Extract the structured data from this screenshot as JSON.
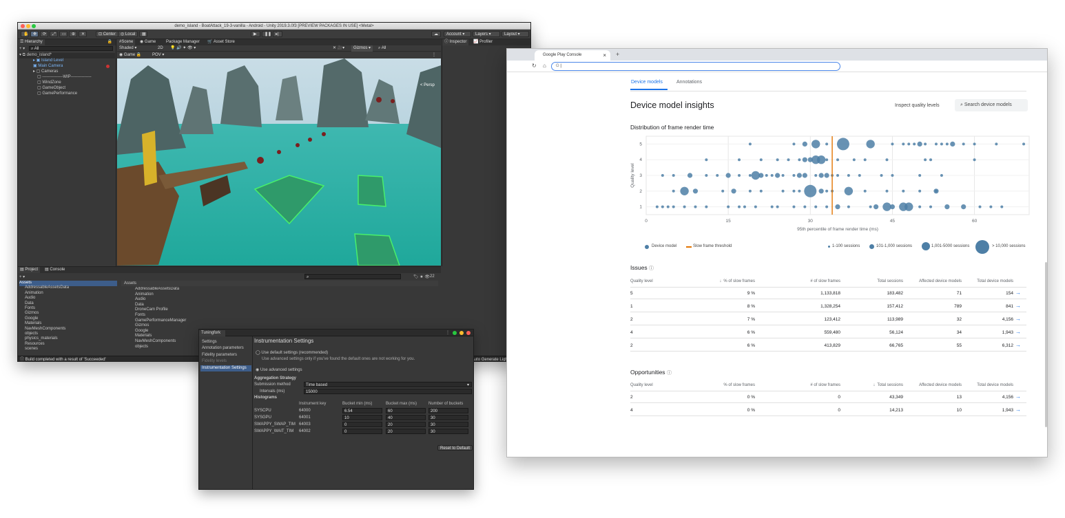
{
  "unity": {
    "title": "demo_island - BoatAttack_19-3-vanilla - Android - Unity 2019.3.0f3 [PREVIEW PACKAGES IN USE] <Metal>",
    "toolbar": {
      "center": "Center",
      "local": "Local",
      "account": "Account",
      "layers": "Layers",
      "layout": "Layout"
    },
    "hierarchy": {
      "tab": "Hierarchy",
      "search": "All",
      "scene": "demo_island*",
      "items": [
        "Island Level",
        "Main Camera",
        "Cameras",
        "---------------WIP---------------",
        "WindZone",
        "GameObject",
        "GamePerformance"
      ]
    },
    "scene_tabs": [
      "Scene",
      "Game",
      "Package Manager",
      "Asset Store"
    ],
    "scene_bar": {
      "shading": "Shaded",
      "mode": "2D",
      "gizmos": "Gizmos",
      "all": "All"
    },
    "game_bar": {
      "game": "Game",
      "pov": "POV"
    },
    "persp_label": "< Persp",
    "inspector_tabs": [
      "Inspector",
      "Profiler"
    ],
    "project_tabs": [
      "Project",
      "Console"
    ],
    "project_count": "22",
    "project_tree": [
      "Assets",
      "AddressableAssetsData",
      "Animation",
      "Audio",
      "Data",
      "Fonts",
      "Gizmos",
      "Google",
      "Materials",
      "NavMeshComponents",
      "objects",
      "physics_materials",
      "Resources",
      "scenes",
      "Scripts"
    ],
    "assets_header": "Assets",
    "assets_list": [
      "AddressableAssetsData",
      "Animation",
      "Audio",
      "Data",
      "DroneCam Profile",
      "Fonts",
      "GamePerformanceManager",
      "Gizmos",
      "Google",
      "Materials",
      "NavMeshComponents",
      "objects"
    ],
    "status": "Build completed with a result of 'Succeeded'",
    "status_right": "Auto Generate Lighting Off"
  },
  "tuningfork": {
    "tab": "Tuningfork",
    "nav": [
      "Settings",
      "Annotation parameters",
      "Fidelity parameters",
      "Fidelity levels",
      "Instrumentation Settings"
    ],
    "heading": "Instrumentation Settings",
    "opt_default": "Use default settings (recommended)",
    "opt_default_note": "Use advanced settings only if you've found the default ones are not working for you.",
    "opt_advanced": "Use advanced settings",
    "aggregation": "Aggregation Strategy",
    "submission_label": "Submission method",
    "submission_value": "Time based",
    "intervals_label": "Intervals (ms)",
    "intervals_value": "15000",
    "histograms": "Histograms",
    "hist_cols": [
      "Instrument key",
      "Bucket min (ms)",
      "Bucket max (ms)",
      "Number of buckets"
    ],
    "hist_rows": [
      [
        "SYSCPU",
        "64000",
        "6.54",
        "60",
        "200"
      ],
      [
        "SYSGPU",
        "64001",
        "10",
        "40",
        "30"
      ],
      [
        "SWAPPY_SWAP_TIM",
        "64003",
        "0",
        "20",
        "30"
      ],
      [
        "SWAPPY_WAIT_TIM",
        "64002",
        "0",
        "20",
        "30"
      ]
    ],
    "reset": "Reset to Default"
  },
  "chrome": {
    "tab_title": "Google Play Console",
    "tab_close": "×",
    "new_tab": "+",
    "addr_letter": "G",
    "addr_value": "|"
  },
  "console": {
    "tabs": [
      "Device models",
      "Annotations"
    ],
    "page_title": "Device model insights",
    "inspect": "Inspect quality levels",
    "search_placeholder": "Search device models",
    "chart_title": "Distribution of frame render time",
    "legend": {
      "device": "Device model",
      "threshold": "Slow frame threshold",
      "s1": "1-100 sessions",
      "s2": "101-1,000 sessions",
      "s3": "1,001-5000 sessions",
      "s4": "> 10,000 sessions"
    },
    "issues": {
      "title": "Issues",
      "cols": [
        "Quality level",
        "% of slow frames",
        "# of slow frames",
        "Total sessions",
        "Affected device models",
        "Total device models"
      ],
      "rows": [
        [
          "5",
          "9 %",
          "1,133,818",
          "183,482",
          "71",
          "154"
        ],
        [
          "1",
          "8 %",
          "1,328,254",
          "157,412",
          "789",
          "841"
        ],
        [
          "2",
          "7 %",
          "123,412",
          "113,989",
          "32",
          "4,156"
        ],
        [
          "4",
          "6 %",
          "559,480",
          "56,124",
          "34",
          "1,943"
        ],
        [
          "2",
          "6 %",
          "413,829",
          "66,765",
          "55",
          "6,312"
        ]
      ]
    },
    "opportunities": {
      "title": "Opportunities",
      "cols": [
        "Quality level",
        "% of slow frames",
        "# of slow frames",
        "Total sessions",
        "Affected device models",
        "Total device models"
      ],
      "rows": [
        [
          "2",
          "0 %",
          "0",
          "43,349",
          "13",
          "4,156"
        ],
        [
          "4",
          "0 %",
          "0",
          "14,213",
          "10",
          "1,943"
        ]
      ]
    },
    "colors": {
      "accent": "#1a73e8",
      "dot": "#4e7fa6",
      "threshold": "#e37400"
    }
  },
  "chart_data": {
    "type": "scatter",
    "title": "Distribution of frame render time",
    "xlabel": "95th percentile of frame render time (ms)",
    "ylabel": "Quality level",
    "xlim": [
      0,
      70
    ],
    "ylim": [
      0.5,
      5.5
    ],
    "xticks": [
      "0",
      "15",
      "30",
      "45",
      "60"
    ],
    "yticks": [
      "1",
      "2",
      "3",
      "4",
      "5"
    ],
    "threshold_x": 34,
    "series": [
      {
        "name": "Device model",
        "points": [
          [
            19,
            5,
            1
          ],
          [
            27,
            5,
            1
          ],
          [
            29,
            5,
            2
          ],
          [
            31,
            5,
            3
          ],
          [
            33,
            5,
            1
          ],
          [
            36,
            5,
            4
          ],
          [
            41,
            5,
            3
          ],
          [
            45,
            5,
            1
          ],
          [
            47,
            5,
            1
          ],
          [
            48,
            5,
            1
          ],
          [
            49,
            5,
            1
          ],
          [
            50,
            5,
            2
          ],
          [
            51,
            5,
            1
          ],
          [
            53,
            5,
            1
          ],
          [
            54,
            5,
            1
          ],
          [
            55,
            5,
            1
          ],
          [
            56,
            5,
            2
          ],
          [
            58,
            5,
            1
          ],
          [
            60,
            5,
            1
          ],
          [
            64,
            5,
            1
          ],
          [
            69,
            5,
            1
          ],
          [
            11,
            4,
            1
          ],
          [
            17,
            4,
            1
          ],
          [
            21,
            4,
            1
          ],
          [
            24,
            4,
            1
          ],
          [
            26,
            4,
            1
          ],
          [
            28,
            4,
            1
          ],
          [
            29,
            4,
            2
          ],
          [
            30,
            4,
            2
          ],
          [
            31,
            4,
            3
          ],
          [
            32,
            4,
            3
          ],
          [
            33,
            4,
            1
          ],
          [
            35,
            4,
            1
          ],
          [
            38,
            4,
            1
          ],
          [
            40,
            4,
            1
          ],
          [
            44,
            4,
            1
          ],
          [
            51,
            4,
            1
          ],
          [
            52,
            4,
            1
          ],
          [
            60,
            4,
            1
          ],
          [
            3,
            3,
            1
          ],
          [
            5,
            3,
            1
          ],
          [
            8,
            3,
            2
          ],
          [
            11,
            3,
            1
          ],
          [
            13,
            3,
            1
          ],
          [
            15,
            3,
            2
          ],
          [
            17,
            3,
            1
          ],
          [
            19,
            3,
            1
          ],
          [
            20,
            3,
            3
          ],
          [
            21,
            3,
            2
          ],
          [
            22,
            3,
            1
          ],
          [
            23,
            3,
            1
          ],
          [
            24,
            3,
            2
          ],
          [
            25,
            3,
            1
          ],
          [
            27,
            3,
            1
          ],
          [
            28,
            3,
            2
          ],
          [
            29,
            3,
            2
          ],
          [
            31,
            3,
            1
          ],
          [
            32,
            3,
            2
          ],
          [
            33,
            3,
            2
          ],
          [
            34,
            3,
            1
          ],
          [
            35,
            3,
            1
          ],
          [
            37,
            3,
            1
          ],
          [
            39,
            3,
            1
          ],
          [
            43,
            3,
            1
          ],
          [
            45,
            3,
            1
          ],
          [
            50,
            3,
            1
          ],
          [
            54,
            3,
            1
          ],
          [
            5,
            2,
            1
          ],
          [
            7,
            2,
            3
          ],
          [
            9,
            2,
            2
          ],
          [
            14,
            2,
            1
          ],
          [
            16,
            2,
            2
          ],
          [
            19,
            2,
            1
          ],
          [
            21,
            2,
            1
          ],
          [
            25,
            2,
            1
          ],
          [
            27,
            2,
            1
          ],
          [
            28,
            2,
            1
          ],
          [
            30,
            2,
            4
          ],
          [
            32,
            2,
            2
          ],
          [
            33,
            2,
            1
          ],
          [
            34,
            2,
            1
          ],
          [
            37,
            2,
            3
          ],
          [
            40,
            2,
            1
          ],
          [
            44,
            2,
            1
          ],
          [
            47,
            2,
            1
          ],
          [
            50,
            2,
            1
          ],
          [
            53,
            2,
            1
          ],
          [
            53,
            2,
            2
          ],
          [
            2,
            1,
            1
          ],
          [
            3,
            1,
            1
          ],
          [
            4,
            1,
            1
          ],
          [
            5,
            1,
            1
          ],
          [
            7,
            1,
            1
          ],
          [
            9,
            1,
            1
          ],
          [
            11,
            1,
            1
          ],
          [
            15,
            1,
            1
          ],
          [
            17,
            1,
            1
          ],
          [
            18,
            1,
            1
          ],
          [
            20,
            1,
            1
          ],
          [
            23,
            1,
            1
          ],
          [
            24,
            1,
            1
          ],
          [
            27,
            1,
            1
          ],
          [
            29,
            1,
            1
          ],
          [
            31,
            1,
            1
          ],
          [
            33,
            1,
            1
          ],
          [
            35,
            1,
            2
          ],
          [
            37,
            1,
            1
          ],
          [
            41,
            1,
            1
          ],
          [
            42,
            1,
            2
          ],
          [
            44,
            1,
            3
          ],
          [
            45,
            1,
            2
          ],
          [
            47,
            1,
            3
          ],
          [
            48,
            1,
            3
          ],
          [
            50,
            1,
            1
          ],
          [
            52,
            1,
            1
          ],
          [
            55,
            1,
            2
          ],
          [
            58,
            1,
            2
          ],
          [
            61,
            1,
            1
          ],
          [
            63,
            1,
            1
          ],
          [
            65,
            1,
            1
          ]
        ]
      }
    ]
  }
}
